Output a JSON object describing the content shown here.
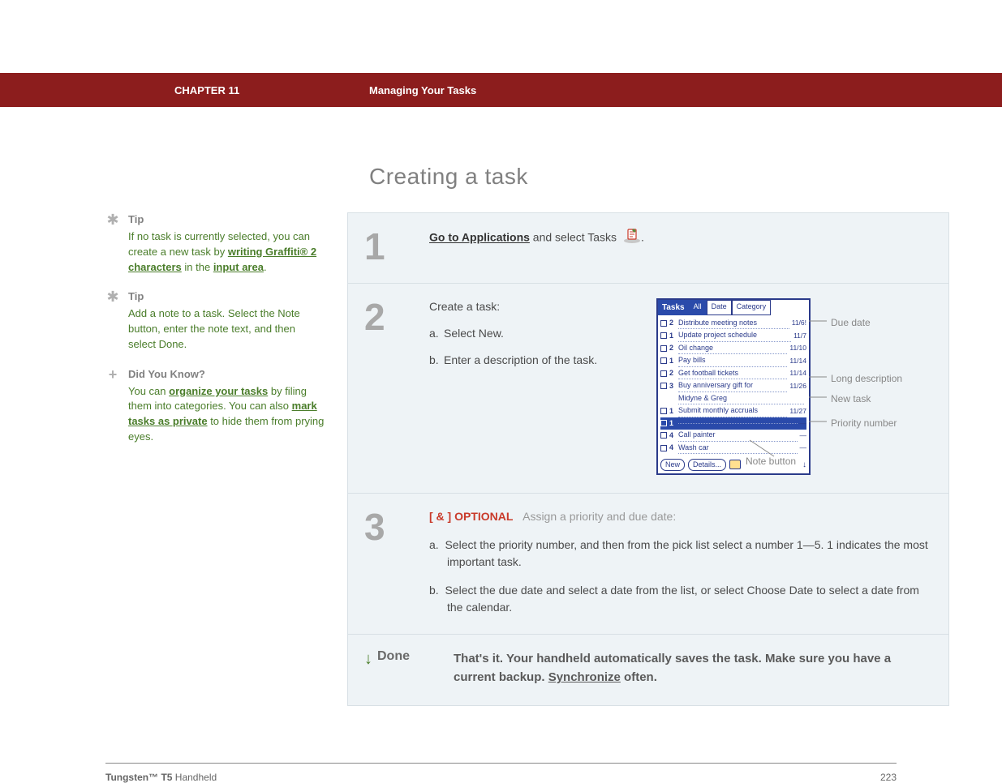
{
  "header": {
    "chapter": "CHAPTER 11",
    "title": "Managing Your Tasks"
  },
  "heading": "Creating a task",
  "sidebar": {
    "tip1": {
      "label": "Tip",
      "t1": "If no task is currently selected, you can create a new task by ",
      "link1": "writing Graffiti® 2 characters",
      "t2": " in the ",
      "link2": "input area",
      "t3": "."
    },
    "tip2": {
      "label": "Tip",
      "text": "Add a note to a task. Select the Note button, enter the note text, and then select Done."
    },
    "dyk": {
      "label": "Did You Know?",
      "t1": "You can ",
      "link1": "organize your tasks",
      "t2": " by filing them into categories. You can also ",
      "link2": "mark tasks as private",
      "t3": " to hide them from prying eyes."
    }
  },
  "steps": {
    "s1": {
      "num": "1",
      "link": "Go to Applications",
      "rest": " and select Tasks "
    },
    "s2": {
      "num": "2",
      "lead": "Create a task:",
      "a": "Select New.",
      "b": "Enter a description of the task."
    },
    "s3": {
      "num": "3",
      "tag": "[ & ]  OPTIONAL",
      "head": "Assign a priority and due date:",
      "a": "Select the priority number, and then from the pick list select a number 1—5. 1 indicates the most important task.",
      "b": "Select the due date and select a date from the list, or select Choose Date to select a date from the calendar."
    },
    "done": {
      "label": "Done",
      "t1": "That's it. Your handheld automatically saves the task. Make sure you have a current backup. ",
      "link": "Synchronize",
      "t2": " often."
    }
  },
  "pda": {
    "title": "Tasks",
    "tabs": {
      "all": "All",
      "date": "Date",
      "cat": "Category"
    },
    "rows": [
      {
        "pri": "2",
        "desc": "Distribute meeting notes",
        "date": "11/6!",
        "alarm": true
      },
      {
        "pri": "1",
        "desc": "Update project schedule",
        "date": "11/7"
      },
      {
        "pri": "2",
        "desc": "Oil change",
        "date": "11/10"
      },
      {
        "pri": "1",
        "desc": "Pay bills",
        "date": "11/14"
      },
      {
        "pri": "2",
        "desc": "Get football tickets",
        "date": "11/14"
      },
      {
        "pri": "3",
        "desc": "Buy anniversary gift for",
        "date": "11/26"
      },
      {
        "pri": "",
        "desc": "Midyne & Greg",
        "date": "",
        "indent": true
      },
      {
        "pri": "1",
        "desc": "Submit monthly accruals",
        "date": "11/27"
      },
      {
        "pri": "1",
        "desc": "",
        "date": "—",
        "selected": true
      },
      {
        "pri": "4",
        "desc": "Call painter",
        "date": "—"
      },
      {
        "pri": "4",
        "desc": "Wash car",
        "date": "—"
      }
    ],
    "btns": {
      "new": "New",
      "details": "Details..."
    }
  },
  "callouts": {
    "duedate": "Due date",
    "longdesc": "Long description",
    "newtask": "New task",
    "priority": "Priority number",
    "notebtn": "Note button"
  },
  "footer": {
    "product_b": "Tungsten™ T5",
    "product_r": " Handheld",
    "page": "223"
  }
}
